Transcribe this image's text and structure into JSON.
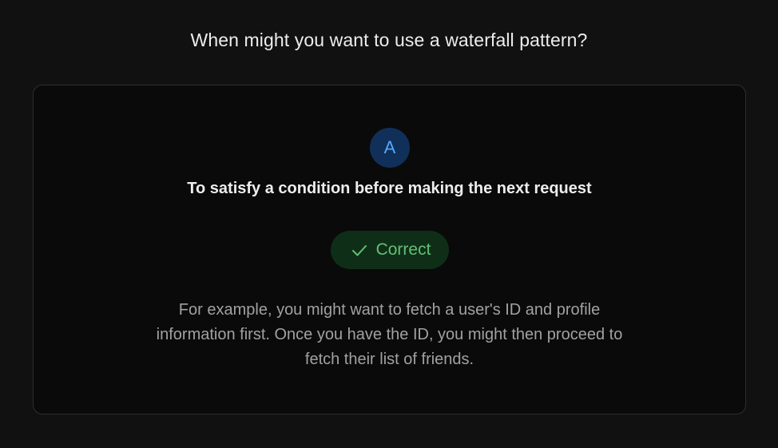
{
  "question": "When might you want to use a waterfall pattern?",
  "option": {
    "letter": "A",
    "text": "To satisfy a condition before making the next request"
  },
  "result": {
    "icon": "check-icon",
    "label": "Correct",
    "color": "#62c073"
  },
  "explanation": "For example, you might want to fetch a user's ID and profile information first. Once you have the ID, you might then proceed to fetch their list of friends.",
  "colors": {
    "background": "#111111",
    "card": "#0a0a0a",
    "badge_bg": "#10305a",
    "badge_text": "#52a8ff",
    "pill_bg": "#0f2e18"
  }
}
